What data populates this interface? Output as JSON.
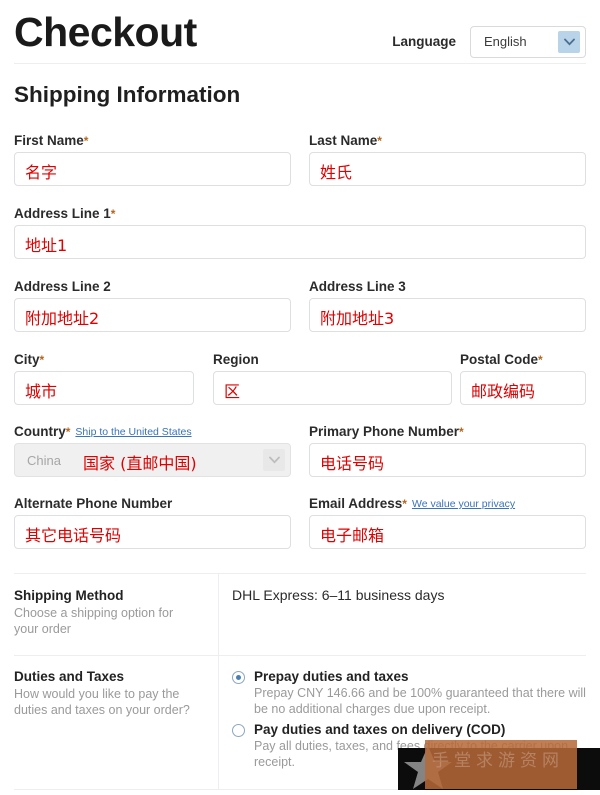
{
  "header": {
    "title": "Checkout",
    "language_label": "Language",
    "language_value": "English"
  },
  "section": {
    "title": "Shipping Information"
  },
  "fields": {
    "first_name": {
      "label": "First Name",
      "required": "*",
      "value": "名字"
    },
    "last_name": {
      "label": "Last Name",
      "required": "*",
      "value": "姓氏"
    },
    "address1": {
      "label": "Address Line 1",
      "required": "*",
      "value": "地址1"
    },
    "address2": {
      "label": "Address Line 2",
      "required": "",
      "value": "附加地址2"
    },
    "address3": {
      "label": "Address Line 3",
      "required": "",
      "value": "附加地址3"
    },
    "city": {
      "label": "City",
      "required": "*",
      "value": "城市"
    },
    "region": {
      "label": "Region",
      "required": "",
      "value": "区"
    },
    "postal_code": {
      "label": "Postal Code",
      "required": "*",
      "value": "邮政编码"
    },
    "country": {
      "label": "Country",
      "required": "*",
      "link": "Ship to the United States",
      "select_value": "China",
      "value": "国家 (直邮中国)"
    },
    "primary_phone": {
      "label": "Primary Phone Number",
      "required": "*",
      "value": "电话号码"
    },
    "alt_phone": {
      "label": "Alternate Phone Number",
      "required": "",
      "value": "其它电话号码"
    },
    "email": {
      "label": "Email Address",
      "required": "*",
      "link": "We value your privacy",
      "value": "电子邮箱"
    }
  },
  "shipping_method": {
    "label": "Shipping Method",
    "description": "Choose a shipping option for your order",
    "value": "DHL Express: 6–11 business days"
  },
  "duties_and_taxes": {
    "label": "Duties and Taxes",
    "description": "How would you like to pay the duties and taxes on your order?",
    "options": [
      {
        "title": "Prepay duties and taxes",
        "description": "Prepay CNY 146.66 and be 100% guaranteed that there will be no additional charges due upon receipt.",
        "selected": true
      },
      {
        "title": "Pay duties and taxes on delivery (COD)",
        "description": "Pay all duties, taxes, and fees directly to the carrier upon receipt.",
        "selected": false
      }
    ]
  },
  "watermark": {
    "text": "手堂求游资网"
  },
  "colors": {
    "required_asterisk": "#b5651d",
    "link": "#3a73b8",
    "annotation_red": "#e00000",
    "radio_selected": "#4a7fb5",
    "watermark_orange": "#b76838"
  }
}
